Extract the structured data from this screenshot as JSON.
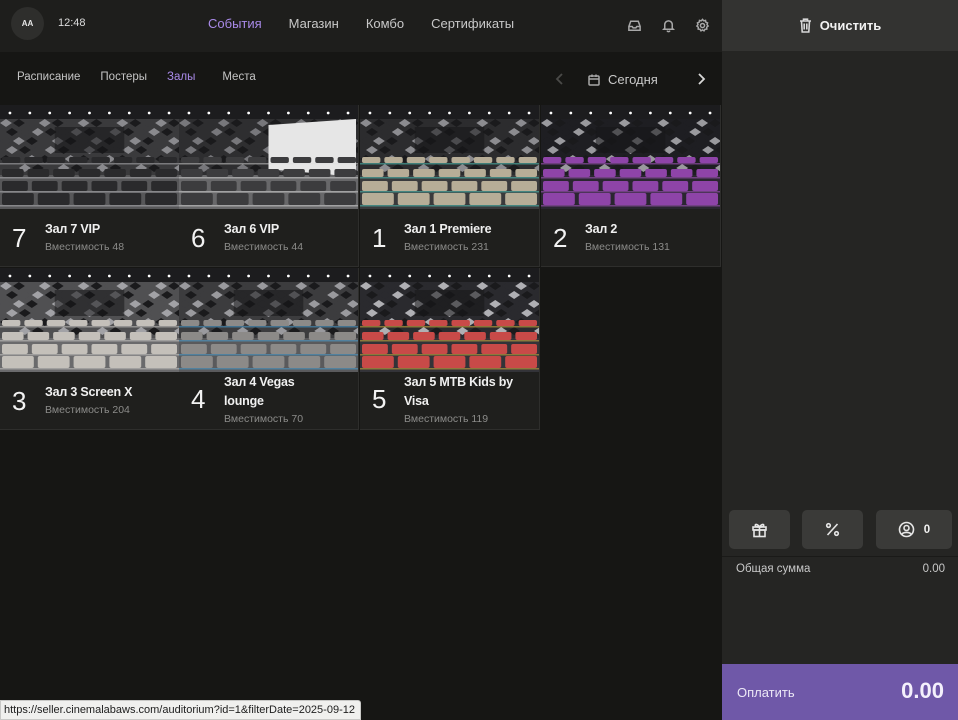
{
  "header": {
    "avatar_initials": "AA",
    "time": "12:48",
    "nav": [
      {
        "label": "События",
        "active": true
      },
      {
        "label": "Магазин",
        "active": false
      },
      {
        "label": "Комбо",
        "active": false
      },
      {
        "label": "Сертификаты",
        "active": false
      }
    ],
    "icons": [
      "inbox-icon",
      "bell-icon",
      "gear-icon"
    ]
  },
  "subnav": {
    "tabs": [
      {
        "label": "Расписание",
        "active": false
      },
      {
        "label": "Постеры",
        "active": false
      },
      {
        "label": "Залы",
        "active": true
      },
      {
        "label": "Места",
        "active": false
      }
    ],
    "date_label": "Сегодня"
  },
  "halls": [
    {
      "number": "7",
      "name": "Зал 7 VIP",
      "capacity": "Вместимость 48",
      "theme": "gray"
    },
    {
      "number": "6",
      "name": "Зал 6 VIP",
      "capacity": "Вместимость 44",
      "theme": "screen"
    },
    {
      "number": "1",
      "name": "Зал 1 Premiere",
      "capacity": "Вместимость 231",
      "theme": "beige"
    },
    {
      "number": "2",
      "name": "Зал 2",
      "capacity": "Вместимость 131",
      "theme": "purple"
    },
    {
      "number": "3",
      "name": "Зал 3 Screen X",
      "capacity": "Вместимость 204",
      "theme": "light"
    },
    {
      "number": "4",
      "name": "Зал 4 Vegas lounge",
      "name_lines": [
        "Зал 4 Vegas",
        "lounge"
      ],
      "capacity": "Вместимость 70",
      "theme": "lounge"
    },
    {
      "number": "5",
      "name": "Зал 5 MTB Kids by Visa",
      "name_lines": [
        "Зал 5 MTB Kids by",
        "Visa"
      ],
      "capacity": "Вместимость 119",
      "theme": "kids"
    }
  ],
  "cart": {
    "clear_label": "Очистить",
    "customer_count": "0",
    "total_label": "Общая сумма",
    "total_value": "0.00",
    "pay_label": "Оплатить",
    "pay_amount": "0.00"
  },
  "status_url": "https://seller.cinemalabaws.com/auditorium?id=1&filterDate=2025-09-12",
  "colors": {
    "accent": "#a98ae8",
    "pay_button": "#6f58a8",
    "background": "#161614"
  }
}
